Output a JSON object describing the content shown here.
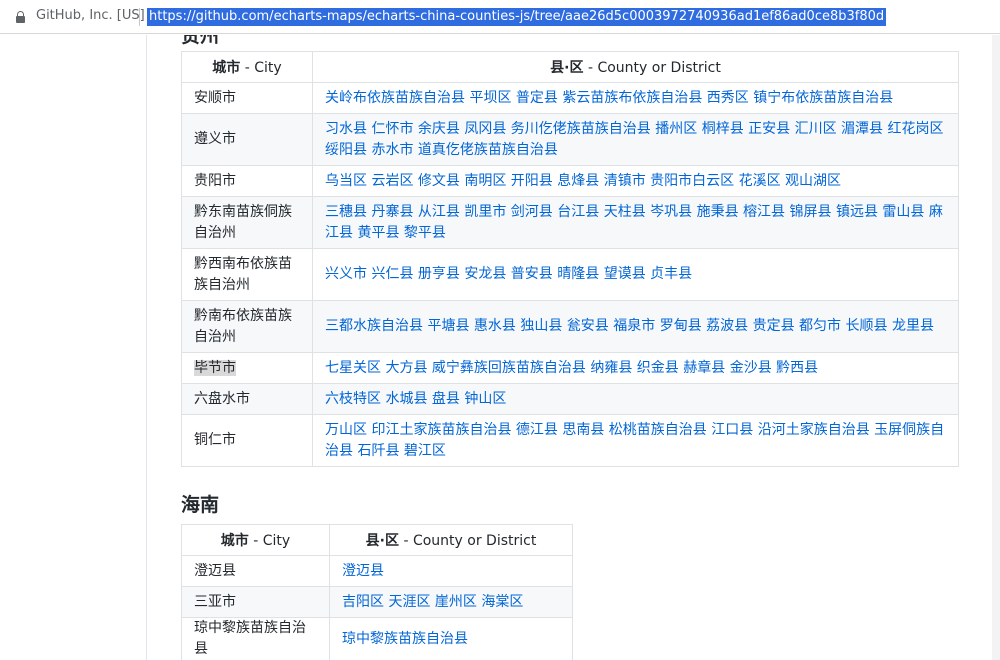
{
  "browser": {
    "site_identity": "GitHub, Inc. [US]",
    "url": "https://github.com/echarts-maps/echarts-china-counties-js/tree/aae26d5c0003972740936ad1ef86ad0ce8b3f80d"
  },
  "guizhou": {
    "heading_clipped": "贵州",
    "header": {
      "city_cn": "城市",
      "city_en": " - City",
      "district_cn": "县·区",
      "district_en": " - County or District"
    },
    "rows": [
      {
        "city": "安顺市",
        "districts": "关岭布依族苗族自治县 平坝区 普定县 紫云苗族布依族自治县 西秀区 镇宁布依族苗族自治县"
      },
      {
        "city": "遵义市",
        "districts": "习水县 仁怀市 余庆县 凤冈县 务川仡佬族苗族自治县 播州区 桐梓县 正安县 汇川区 湄潭县 红花岗区 绥阳县 赤水市 道真仡佬族苗族自治县"
      },
      {
        "city": "贵阳市",
        "districts": "乌当区 云岩区 修文县 南明区 开阳县 息烽县 清镇市 贵阳市白云区 花溪区 观山湖区"
      },
      {
        "city": "黔东南苗族侗族自治州",
        "districts": "三穗县 丹寨县 从江县 凯里市 剑河县 台江县 天柱县 岑巩县 施秉县 榕江县 锦屏县 镇远县 雷山县 麻江县 黄平县 黎平县"
      },
      {
        "city": "黔西南布依族苗族自治州",
        "districts": "兴义市 兴仁县 册亨县 安龙县 普安县 晴隆县 望谟县 贞丰县"
      },
      {
        "city": "黔南布依族苗族自治州",
        "districts": "三都水族自治县 平塘县 惠水县 独山县 瓮安县 福泉市 罗甸县 荔波县 贵定县 都匀市 长顺县 龙里县"
      },
      {
        "city": "毕节市",
        "districts": "七星关区 大方县 威宁彝族回族苗族自治县 纳雍县 织金县 赫章县 金沙县 黔西县"
      },
      {
        "city": "六盘水市",
        "districts": "六枝特区 水城县 盘县 钟山区"
      },
      {
        "city": "铜仁市",
        "districts": "万山区 印江土家族苗族自治县 德江县 思南县 松桃苗族自治县 江口县 沿河土家族自治县 玉屏侗族自治县 石阡县 碧江区"
      }
    ]
  },
  "hainan": {
    "heading": "海南",
    "header": {
      "city_cn": "城市",
      "city_en": " - City",
      "district_cn": "县·区",
      "district_en": " - County or District"
    },
    "rows": [
      {
        "city": "澄迈县",
        "districts": "澄迈县"
      },
      {
        "city": "三亚市",
        "districts": "吉阳区 天涯区 崖州区 海棠区"
      },
      {
        "city": "琼中黎族苗族自治县",
        "districts": "琼中黎族苗族自治县"
      }
    ]
  }
}
